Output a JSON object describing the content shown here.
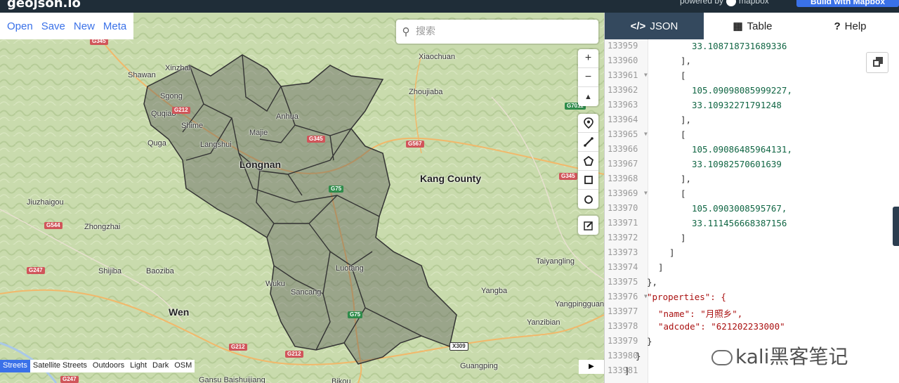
{
  "app": {
    "logo": "geojson.io",
    "powered_by": "powered by",
    "mapbox": "mapbox",
    "build_button": "Build with Mapbox"
  },
  "menu": [
    "Open",
    "Save",
    "New",
    "Meta"
  ],
  "search": {
    "placeholder": "搜索"
  },
  "map_controls": {
    "zoom_in": "+",
    "zoom_out": "−",
    "compass": "▲"
  },
  "draw_tools": [
    "marker-icon",
    "line-icon",
    "polygon-icon",
    "rectangle-icon",
    "circle-icon"
  ],
  "edit_tool": "edit-icon",
  "styles": {
    "items": [
      "Streets",
      "Satellite Streets",
      "Outdoors",
      "Light",
      "Dark",
      "OSM"
    ],
    "active": "Streets"
  },
  "places": [
    {
      "name": "Xinzhai"
    },
    {
      "name": "Shawan"
    },
    {
      "name": "Xiaochuan"
    },
    {
      "name": "Zhoujiaba"
    },
    {
      "name": "Quqiao"
    },
    {
      "name": "Majie"
    },
    {
      "name": "Anhua"
    },
    {
      "name": "Sgong"
    },
    {
      "name": "Quga"
    },
    {
      "name": "Langshui"
    },
    {
      "name": "Shime"
    },
    {
      "name": "Longnan"
    },
    {
      "name": "Kang County"
    },
    {
      "name": "Jiuzhaigou"
    },
    {
      "name": "Zhongzhai"
    },
    {
      "name": "Shijiba"
    },
    {
      "name": "Baoziba"
    },
    {
      "name": "Taiyangling"
    },
    {
      "name": "Luotang"
    },
    {
      "name": "Wuku"
    },
    {
      "name": "Sancang"
    },
    {
      "name": "Yangba"
    },
    {
      "name": "Wen"
    },
    {
      "name": "Yangpingguan"
    },
    {
      "name": "Yanzibian"
    },
    {
      "name": "Guangping"
    },
    {
      "name": "Gansu Baishuijiang"
    },
    {
      "name": "Bikou"
    }
  ],
  "roads": [
    "G345",
    "G212",
    "G345",
    "G567",
    "G75",
    "G345",
    "G544",
    "G247",
    "G212",
    "G212",
    "G75",
    "X309",
    "G247",
    "G7011"
  ],
  "tabs": [
    {
      "icon": "</>",
      "label": "JSON"
    },
    {
      "icon": "▦",
      "label": "Table"
    },
    {
      "icon": "?",
      "label": "Help"
    }
  ],
  "editor": {
    "line_numbers": [
      "133959",
      "133960",
      "133961",
      "133962",
      "133963",
      "133964",
      "133965",
      "133966",
      "133967",
      "133968",
      "133969",
      "133970",
      "133971",
      "133972",
      "133973",
      "133974",
      "133975",
      "133976",
      "133977",
      "133978",
      "133979",
      "133980",
      "133981"
    ],
    "lines": [
      "33.108718731689336",
      "],",
      "[",
      "105.09098085999227,",
      "33.10932271791248",
      "],",
      "[",
      "105.09086485964131,",
      "33.10982570601639",
      "],",
      "[",
      "105.0903008595767,",
      "33.111456668387156",
      "]",
      "]",
      "]",
      "},",
      "\"properties\": {",
      "\"name\": \"月照乡\",",
      "\"adcode\": \"621202233000\"",
      "}",
      "}",
      "]"
    ]
  },
  "watermark": "kali黑客笔记"
}
